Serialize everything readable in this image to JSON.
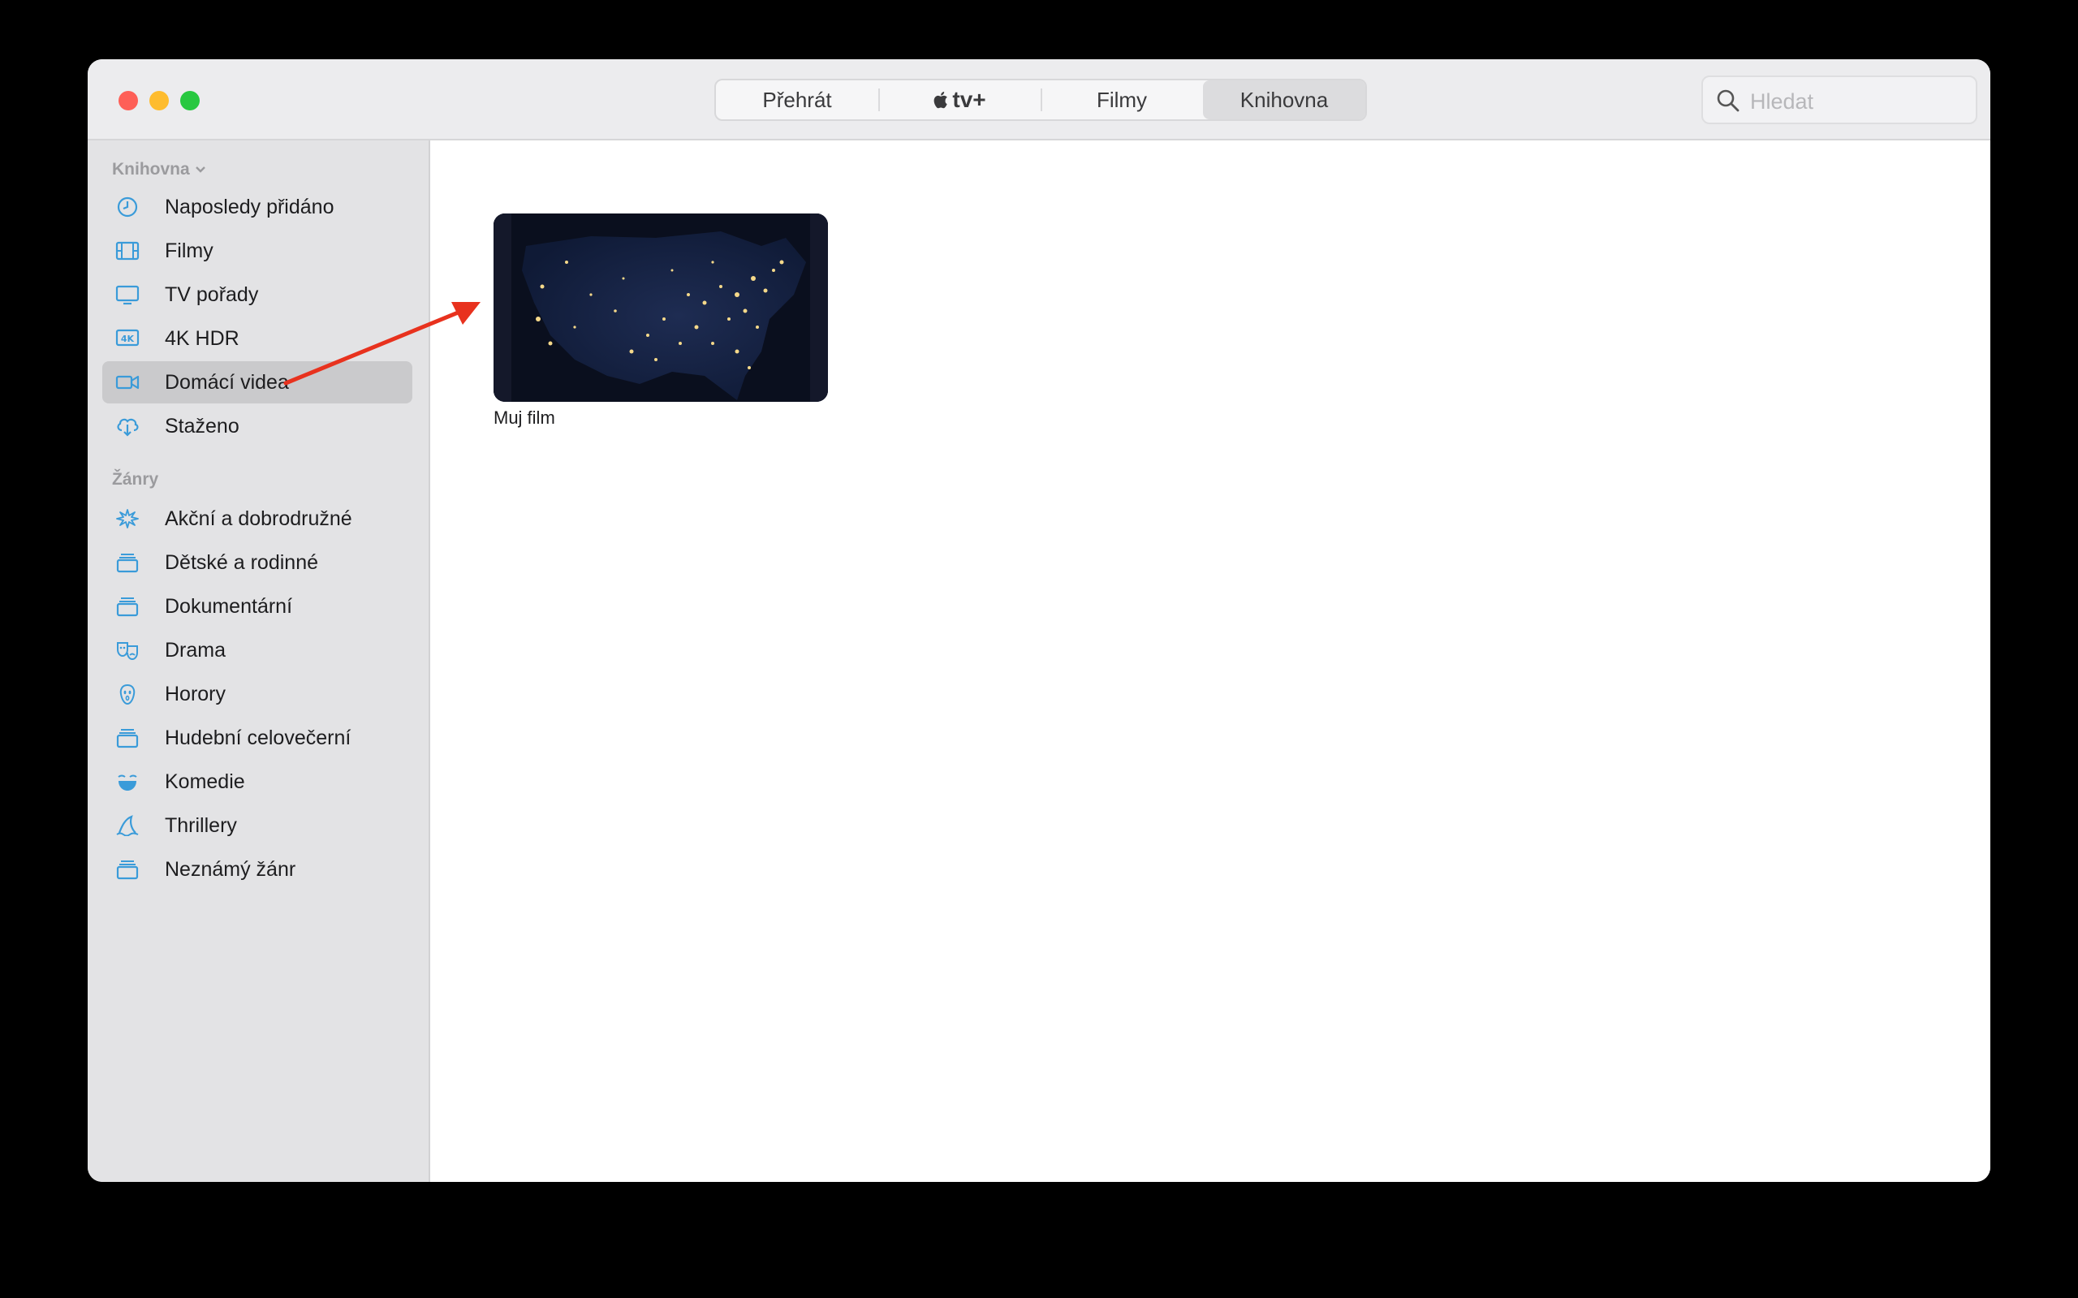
{
  "toolbar": {
    "tabs": [
      {
        "label": "Přehrát"
      },
      {
        "label": "tv+"
      },
      {
        "label": "Filmy"
      },
      {
        "label": "Knihovna"
      }
    ],
    "active_tab": "Knihovna",
    "search": {
      "placeholder": "Hledat",
      "value": ""
    }
  },
  "sidebar": {
    "library_header": "Knihovna",
    "library_items": [
      {
        "label": "Naposledy přidáno",
        "icon": "clock-icon"
      },
      {
        "label": "Filmy",
        "icon": "film-icon"
      },
      {
        "label": "TV pořady",
        "icon": "tv-icon"
      },
      {
        "label": "4K HDR",
        "icon": "4k-icon"
      },
      {
        "label": "Domácí videa",
        "icon": "video-camera-icon",
        "selected": true
      },
      {
        "label": "Staženo",
        "icon": "cloud-download-icon"
      }
    ],
    "genres_header": "Žánry",
    "genre_items": [
      {
        "label": "Akční a dobrodružné",
        "icon": "explosion-icon"
      },
      {
        "label": "Dětské a rodinné",
        "icon": "stack-icon"
      },
      {
        "label": "Dokumentární",
        "icon": "stack-icon"
      },
      {
        "label": "Drama",
        "icon": "theater-masks-icon"
      },
      {
        "label": "Horory",
        "icon": "ghost-face-icon"
      },
      {
        "label": "Hudební celovečerní",
        "icon": "stack-icon"
      },
      {
        "label": "Komedie",
        "icon": "laughing-face-icon"
      },
      {
        "label": "Thrillery",
        "icon": "shark-fin-icon"
      },
      {
        "label": "Neznámý žánr",
        "icon": "stack-icon"
      }
    ]
  },
  "content": {
    "items": [
      {
        "title": "Muj film"
      }
    ]
  },
  "colors": {
    "accent_icon": "#3a9bd9",
    "annotation_arrow": "#e8321e",
    "sidebar_bg": "#e3e3e5",
    "selected_bg": "#cacacc"
  }
}
